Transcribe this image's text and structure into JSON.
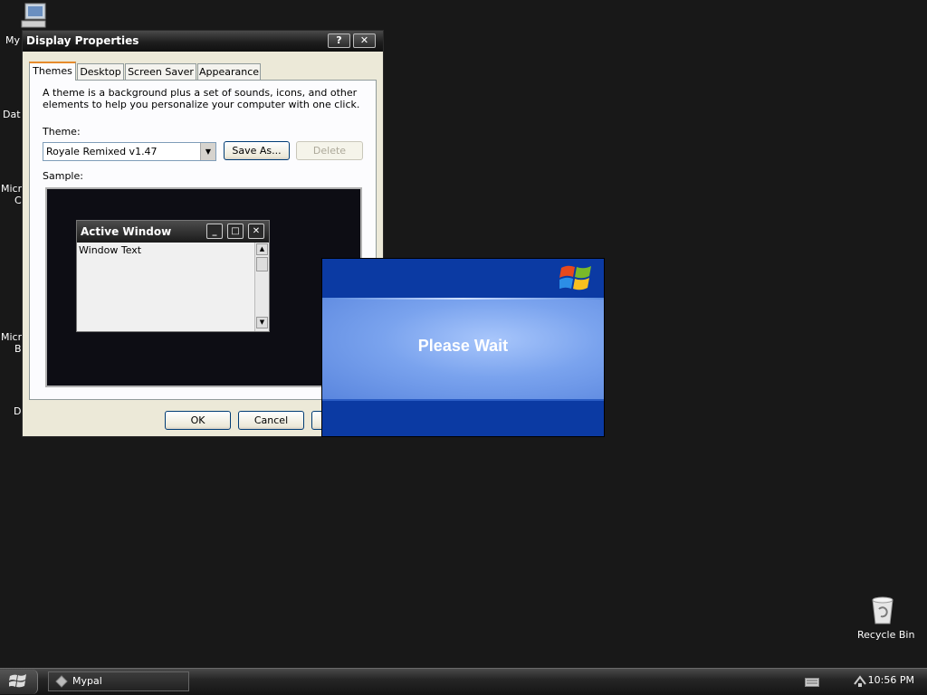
{
  "desktop": {
    "icons": [
      {
        "label": "My"
      },
      {
        "label": "Dat"
      },
      {
        "label": "Micr"
      },
      {
        "label": "C"
      },
      {
        "label": "Micr"
      },
      {
        "label": "B"
      },
      {
        "label": "D"
      }
    ],
    "recycle_bin": {
      "label": "Recycle Bin"
    }
  },
  "display_properties": {
    "title": "Display Properties",
    "help_btn": "?",
    "close_btn": "✕",
    "tabs": [
      {
        "label": "Themes",
        "active": true
      },
      {
        "label": "Desktop"
      },
      {
        "label": "Screen Saver"
      },
      {
        "label": "Appearance"
      }
    ],
    "description": "A theme is a background plus a set of sounds, icons, and other elements to help you personalize your computer with one click.",
    "theme_label": "Theme:",
    "theme_value": "Royale Remixed v1.47",
    "save_as": "Save As...",
    "delete": "Delete",
    "sample_label": "Sample:",
    "sample_window": {
      "title": "Active Window",
      "body_text": "Window Text"
    },
    "ok": "OK",
    "cancel": "Cancel"
  },
  "please_wait": {
    "message": "Please Wait"
  },
  "taskbar": {
    "task_label": "Mypal",
    "clock": "10:56 PM"
  },
  "colors": {
    "desktop": "#181818",
    "dialog_face": "#ece9d8",
    "wait_blue": "#0b3aa3",
    "tab_highlight": "#e68b2c"
  }
}
